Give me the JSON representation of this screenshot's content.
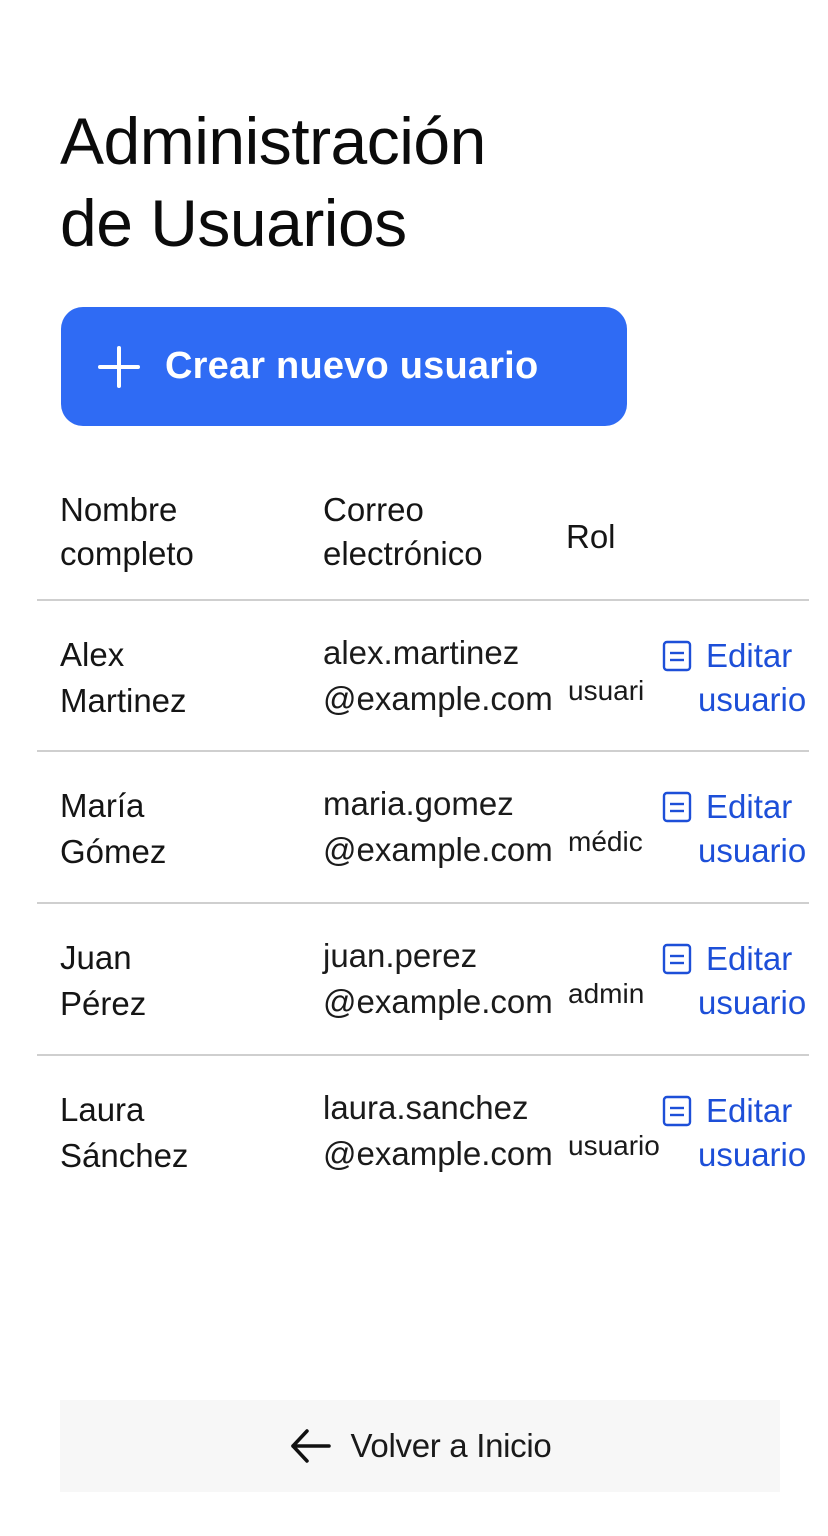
{
  "page": {
    "title_line1": "Administración",
    "title_line2": "de Usuarios"
  },
  "actions": {
    "create_label": "Crear nuevo usuario",
    "create_icon": "plus-icon",
    "accent_color": "#2f6bf4"
  },
  "table": {
    "headers": {
      "name_line1": "Nombre",
      "name_line2": "completo",
      "email_line1": "Correo",
      "email_line2": "electrónico",
      "role": "Rol"
    },
    "rows": [
      {
        "first_name": "Alex",
        "last_name": "Martinez",
        "email_user": "alex.martinez",
        "email_domain": "@example.com",
        "role": "usuari",
        "edit_word1": "Editar",
        "edit_word2": "usuario"
      },
      {
        "first_name": "María",
        "last_name": "Gómez",
        "email_user": "maria.gomez",
        "email_domain": "@example.com",
        "role": "médic",
        "edit_word1": "Editar",
        "edit_word2": "usuario"
      },
      {
        "first_name": "Juan",
        "last_name": "Pérez",
        "email_user": "juan.perez",
        "email_domain": "@example.com",
        "role": "admin",
        "edit_word1": "Editar",
        "edit_word2": "usuario"
      },
      {
        "first_name": "Laura",
        "last_name": "Sánchez",
        "email_user": "laura.sanchez",
        "email_domain": "@example.com",
        "role": "usuario",
        "edit_word1": "Editar",
        "edit_word2": "usuario"
      }
    ],
    "edit_icon": "document-icon",
    "link_color": "#1d4fd8"
  },
  "footer": {
    "back_label": "Volver a Inicio",
    "back_icon": "arrow-left-icon"
  }
}
